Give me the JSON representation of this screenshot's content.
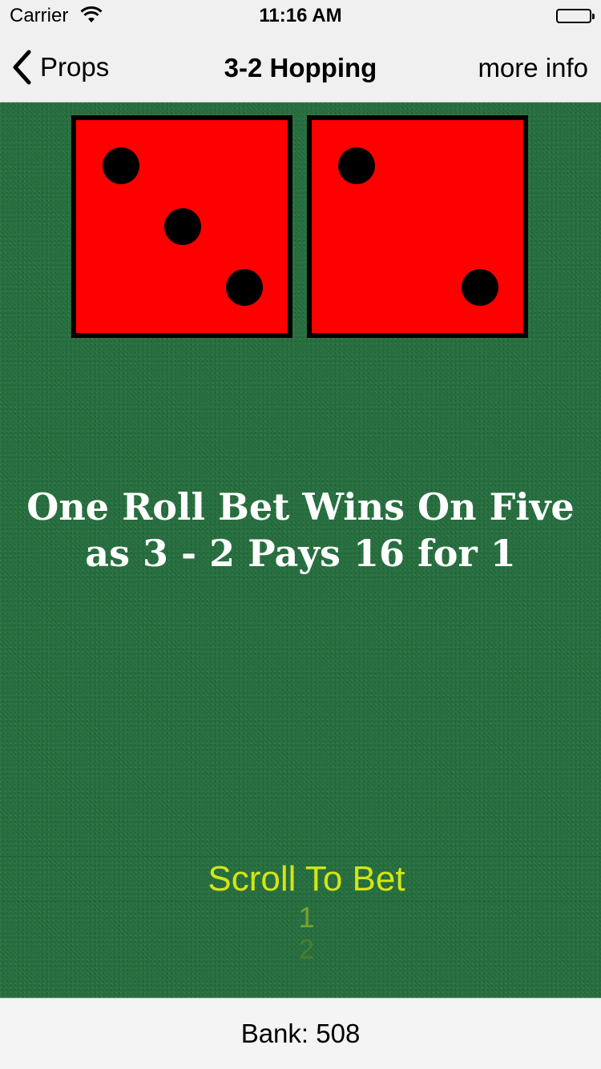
{
  "status_bar": {
    "carrier": "Carrier",
    "time": "11:16 AM"
  },
  "nav": {
    "back_label": "Props",
    "title": "3-2 Hopping",
    "right_label": "more info"
  },
  "dice": {
    "left_value": 3,
    "right_value": 2,
    "color": "#ff0000",
    "pip_color": "#000000"
  },
  "bet": {
    "description": "One Roll Bet Wins On Five as 3 - 2 Pays 16 for 1"
  },
  "picker": {
    "title": "Scroll To Bet",
    "options": [
      "1",
      "2"
    ]
  },
  "footer": {
    "bank": "Bank: 508"
  },
  "colors": {
    "felt": "#26703f",
    "picker_title": "#d4e516"
  }
}
